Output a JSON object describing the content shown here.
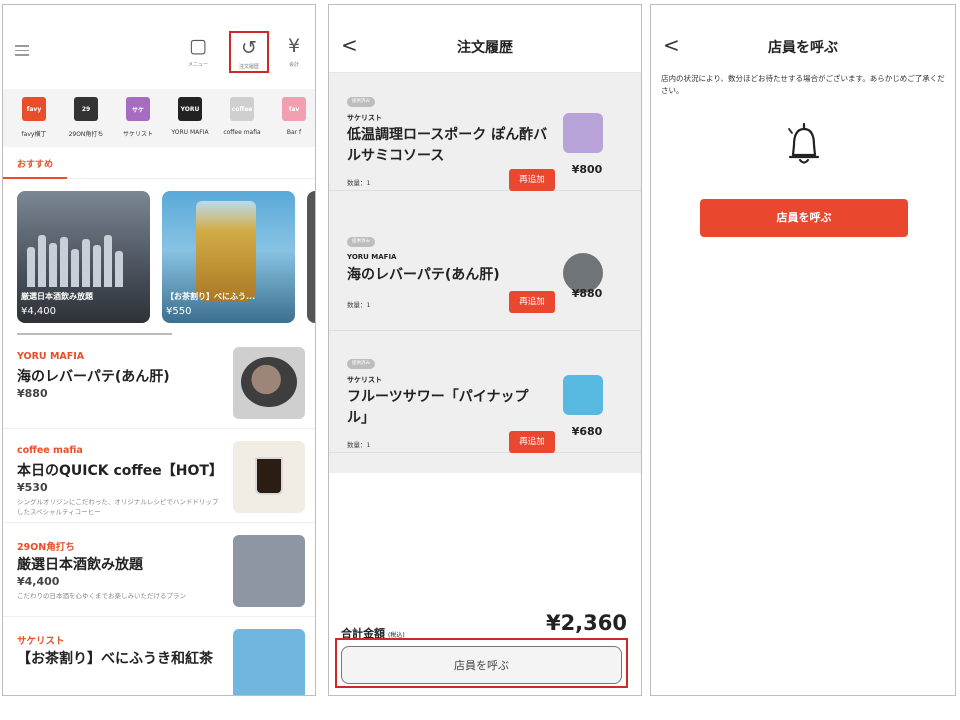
{
  "screen1": {
    "header": {
      "menu_label": "メニュー",
      "history_label": "注文履歴",
      "bill_label": "会計",
      "bill_glyph": "¥"
    },
    "shops": [
      {
        "name": "favy横丁",
        "logo_text": "favy",
        "color": "#e94e2a"
      },
      {
        "name": "29ON角打ち",
        "logo_text": "29",
        "color": "#333333"
      },
      {
        "name": "サケリスト",
        "logo_text": "サケ",
        "color": "#a56cc1"
      },
      {
        "name": "YORU MAFIA",
        "logo_text": "YORU",
        "color": "#222222"
      },
      {
        "name": "coffee mafia",
        "logo_text": "coffee",
        "color": "#cfcfcf"
      },
      {
        "name": "Bar f",
        "logo_text": "fav",
        "color": "#f0a0b0"
      }
    ],
    "tab_recommended": "おすすめ",
    "carousel": [
      {
        "title": "厳選日本酒飲み放題",
        "price": "¥4,400"
      },
      {
        "title": "【お茶割り】べにふう...",
        "price": "¥550"
      }
    ],
    "items": [
      {
        "shop": "YORU MAFIA",
        "name": "海のレバーパテ(あん肝)",
        "price": "¥880",
        "desc": ""
      },
      {
        "shop": "coffee mafia",
        "name": "本日のQUICK coffee【HOT】",
        "price": "¥530",
        "desc": "シングルオリジンにこだわった、オリジナルレシピでハンドドリップしたスペシャルティコーヒー"
      },
      {
        "shop": "29ON角打ち",
        "name": "厳選日本酒飲み放題",
        "price": "¥4,400",
        "desc": "こだわりの日本酒を心ゆくまでお楽しみいただけるプラン"
      },
      {
        "shop": "サケリスト",
        "name": "【お茶割り】べにふうき和紅茶",
        "price": "",
        "desc": ""
      }
    ]
  },
  "screen2": {
    "title": "注文履歴",
    "orders": [
      {
        "badge": "提供済み",
        "shop": "サケリスト",
        "name": "低温調理ロースポーク ぽん酢バルサミコソース",
        "qty": "数量：1",
        "readd": "再追加",
        "price": "¥800"
      },
      {
        "badge": "提供済み",
        "shop": "YORU MAFIA",
        "name": "海のレバーパテ(あん肝)",
        "qty": "数量：1",
        "readd": "再追加",
        "price": "¥880"
      },
      {
        "badge": "提供済み",
        "shop": "サケリスト",
        "name": "フルーツサワー「パイナップル」",
        "qty": "数量：1",
        "readd": "再追加",
        "price": "¥680"
      }
    ],
    "total_label": "合計金額",
    "tax_label": "(税込)",
    "total_value": "¥2,360",
    "call_button": "店員を呼ぶ"
  },
  "screen3": {
    "title": "店員を呼ぶ",
    "note": "店内の状況により、数分ほどお待たせする場合がございます。あらかじめご了承ください。",
    "call_button": "店員を呼ぶ"
  }
}
